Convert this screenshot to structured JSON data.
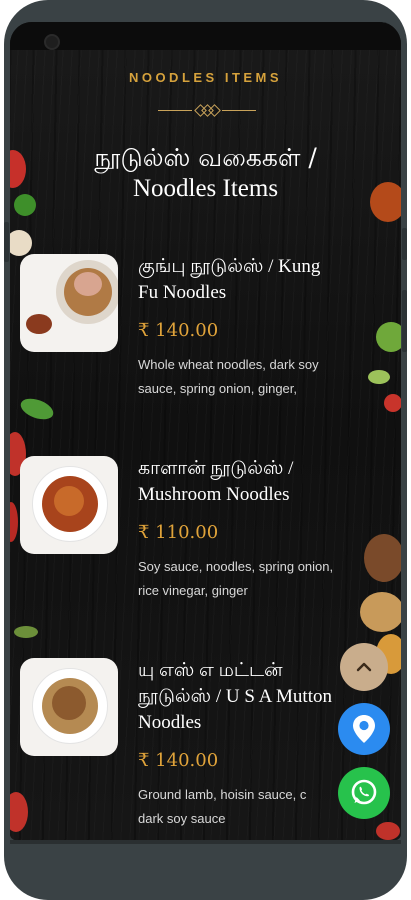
{
  "section": {
    "label": "NOODLES ITEMS"
  },
  "title": {
    "tamil": "நூடுல்ஸ் வகைகள் /",
    "english": "Noodles Items"
  },
  "items": [
    {
      "name_line1": "குங்பு நூடுல்ஸ் / Kung",
      "name_line2": "Fu Noodles",
      "name_line3": "",
      "price": "₹ 140.00",
      "desc_line1": "Whole wheat noodles, dark soy",
      "desc_line2": "sauce, spring onion, ginger,"
    },
    {
      "name_line1": "காளான் நூடுல்ஸ் /",
      "name_line2": "Mushroom Noodles",
      "name_line3": "",
      "price": "₹ 110.00",
      "desc_line1": "Soy sauce, noodles, spring onion,",
      "desc_line2": "rice vinegar, ginger"
    },
    {
      "name_line1": "யு எஸ் எ மட்டன்",
      "name_line2": "நூடுல்ஸ் / U S A Mutton",
      "name_line3": "Noodles",
      "price": "₹ 140.00",
      "desc_line1": "Ground lamb, hoisin sauce, c",
      "desc_line2": "dark soy sauce"
    }
  ],
  "fabs": {
    "scroll_top_icon": "chevron-up-icon",
    "location_icon": "map-pin-icon",
    "whatsapp_icon": "whatsapp-icon"
  },
  "colors": {
    "accent_gold": "#d6a23c",
    "price": "#e0a33a",
    "location_fab": "#2b8bf0",
    "whatsapp_fab": "#27c24c",
    "scroll_fab": "#c9ad8c"
  }
}
